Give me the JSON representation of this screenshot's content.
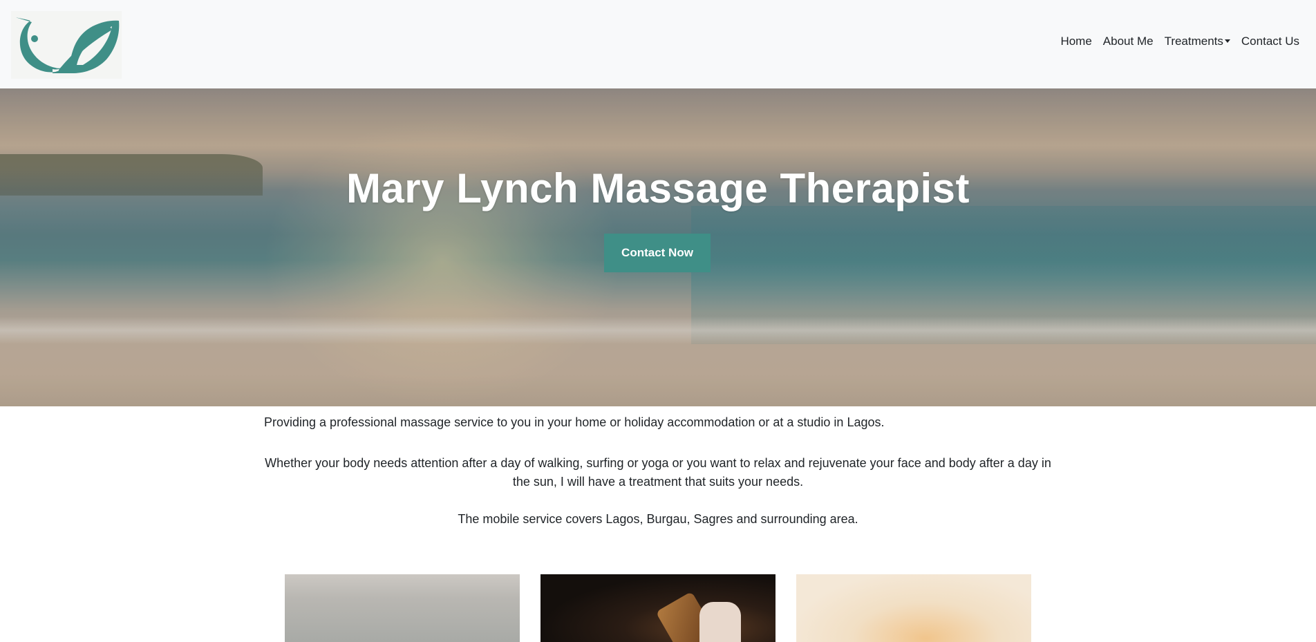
{
  "brand": {
    "logo_icon": "leaf-bird-logo-icon",
    "accent_color": "#3f8f87"
  },
  "nav": {
    "items": [
      {
        "label": "Home"
      },
      {
        "label": "About Me"
      },
      {
        "label": "Treatments",
        "has_dropdown": true
      },
      {
        "label": "Contact Us"
      }
    ]
  },
  "hero": {
    "title": "Mary Lynch Massage Therapist",
    "button_label": "Contact Now"
  },
  "intro": {
    "paragraph_1": "Providing a professional massage service to you in your home or holiday accommodation or at a studio in Lagos.",
    "paragraph_2": "Whether your body needs attention after a day of walking, surfing or yoga or you want to relax and rejuvenate your face and body after a day in the sun, I will have a treatment that suits your needs.",
    "paragraph_3": "The mobile service covers Lagos, Burgau, Sagres and surrounding area."
  }
}
